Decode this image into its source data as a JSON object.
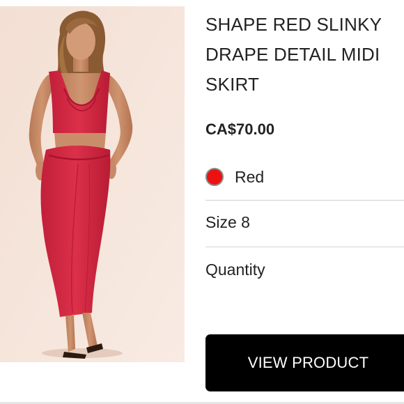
{
  "product": {
    "image_alt": "model wearing red slinky drape top and midi skirt",
    "title": "SHAPE RED SLINKY DRAPE DETAIL MIDI SKIRT",
    "price": "CA$70.00",
    "color": {
      "label": "Red",
      "swatch_hex": "#ee1111"
    },
    "size": "Size 8",
    "quantity_label": "Quantity"
  },
  "actions": {
    "view_product_label": "VIEW PRODUCT"
  },
  "colors": {
    "image_background": "#f6e6dc",
    "garment": "#d42a45",
    "button_background": "#000000",
    "divider": "#d2d2d2"
  }
}
